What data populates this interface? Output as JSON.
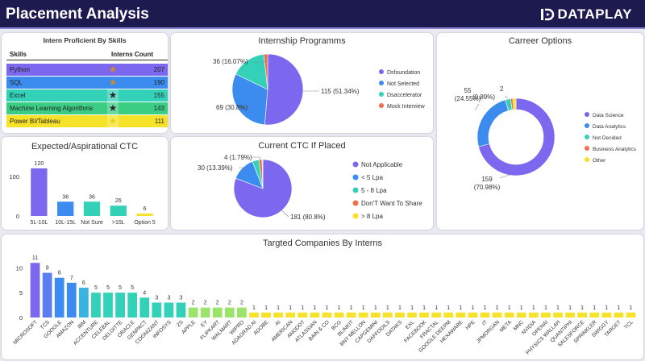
{
  "header": {
    "title": "Placement Analysis",
    "logo_text": "DATAPLAY"
  },
  "colors": {
    "purple": "#7b68ee",
    "blue": "#3c8cf0",
    "teal": "#34d1b9",
    "orange": "#f06e4a",
    "yellow": "#f7e22a"
  },
  "skills": {
    "title": "Intern Proficient By Skills",
    "col_skill": "Skills",
    "col_count": "Interns Count",
    "rows": [
      {
        "name": "Python",
        "count": "207",
        "color": "#7b68ee"
      },
      {
        "name": "SQL",
        "count": "190",
        "color": "#3c8cf0"
      },
      {
        "name": "Excel",
        "count": "155",
        "color": "#34d1b9"
      },
      {
        "name": "Machine Learning Algorithms",
        "count": "143",
        "color": "#3ccd85"
      },
      {
        "name": "Power BI/Tableau",
        "count": "111",
        "color": "#f7e22a"
      }
    ]
  },
  "chart_data": [
    {
      "id": "ctc",
      "type": "bar",
      "title": "Expected/Aspirational CTC",
      "categories": [
        "5L-10L",
        "10L-15L",
        "Not Sure",
        ">15L",
        "Option 5"
      ],
      "values": [
        120,
        36,
        36,
        26,
        6
      ],
      "yticks": [
        "0",
        "100"
      ]
    },
    {
      "id": "programs",
      "type": "pie",
      "title": "Internship Programms",
      "labels": [
        "Dsfoundation",
        "Not Selected",
        "Dsaccelerator",
        "Mock Interview"
      ],
      "values": [
        115,
        69,
        36,
        4
      ],
      "value_labels": [
        "115 (51.34%)",
        "69 (30.8%)",
        "36 (16.07%)",
        ""
      ],
      "colors": [
        "#7b68ee",
        "#3c8cf0",
        "#34d1b9",
        "#f06e4a"
      ]
    },
    {
      "id": "career",
      "type": "pie",
      "title": "Carreer Options",
      "labels": [
        "Data Science",
        "Data Analytics",
        "Not Decided",
        "Business Analytics",
        "Other"
      ],
      "values": [
        159,
        55,
        5,
        2,
        3
      ],
      "value_labels": [
        "159\n(70.98%)",
        "55\n(24.55%)",
        "",
        "2",
        "(0.89%)"
      ],
      "colors": [
        "#7b68ee",
        "#3c8cf0",
        "#34d1b9",
        "#f06e4a",
        "#f7e22a"
      ]
    },
    {
      "id": "current",
      "type": "pie",
      "title": "Current CTC If Placed",
      "labels": [
        "Not Applicable",
        "< 5 Lpa",
        "5 - 8 Lpa",
        "Don'T Want To Share",
        "> 8 Lpa"
      ],
      "values": [
        181,
        30,
        8,
        4,
        1
      ],
      "value_labels": [
        "181 (80.8%)",
        "30 (13.39%)",
        "",
        "4 (1.79%)",
        ""
      ],
      "colors": [
        "#7b68ee",
        "#3c8cf0",
        "#34d1b9",
        "#f06e4a",
        "#f7e22a"
      ]
    },
    {
      "id": "companies",
      "type": "bar",
      "title": "Targted Companies By Interns",
      "categories": [
        "MICROSOFT",
        "TCS",
        "GOOGLE",
        "AMAZON",
        "IBM",
        "ACCENTURE",
        "CELEBAL",
        "DELOITTE",
        "ORACLE",
        "GENPACT",
        "COGNIZANT",
        "INFOSYS",
        "ZS",
        "APPLE",
        "EY",
        "FLIPKART",
        "WALMART",
        "WIPRO",
        "ADAGRAD AI",
        "ADOBE",
        "AI",
        "AMERICAN",
        "ANODOT",
        "ATLASSIAN",
        "BAIN & CO",
        "BCG",
        "BLINKIT",
        "BNY MELLON",
        "CAPGEMINI",
        "DAFFODILS",
        "DATAKS",
        "EXL",
        "FACEBOOK",
        "FRACTAL",
        "GOOGLE DEEPM",
        "HEXAWARE",
        "HPE",
        "IT",
        "JPMORGAN",
        "META",
        "MNC",
        "NVIDIA",
        "OPENAI",
        "PHYSICS WALLAH",
        "QUANTIPHI",
        "SALESFORCE",
        "SPRINKLER",
        "SWIGGY",
        "TARGET",
        "TCL"
      ],
      "values": [
        11,
        9,
        8,
        7,
        6,
        5,
        5,
        5,
        5,
        4,
        3,
        3,
        3,
        2,
        2,
        2,
        2,
        2,
        1,
        1,
        1,
        1,
        1,
        1,
        1,
        1,
        1,
        1,
        1,
        1,
        1,
        1,
        1,
        1,
        1,
        1,
        1,
        1,
        1,
        1,
        1,
        1,
        1,
        1,
        1,
        1,
        1,
        1,
        1,
        1
      ],
      "yticks": [
        "0",
        "5",
        "10"
      ]
    }
  ]
}
